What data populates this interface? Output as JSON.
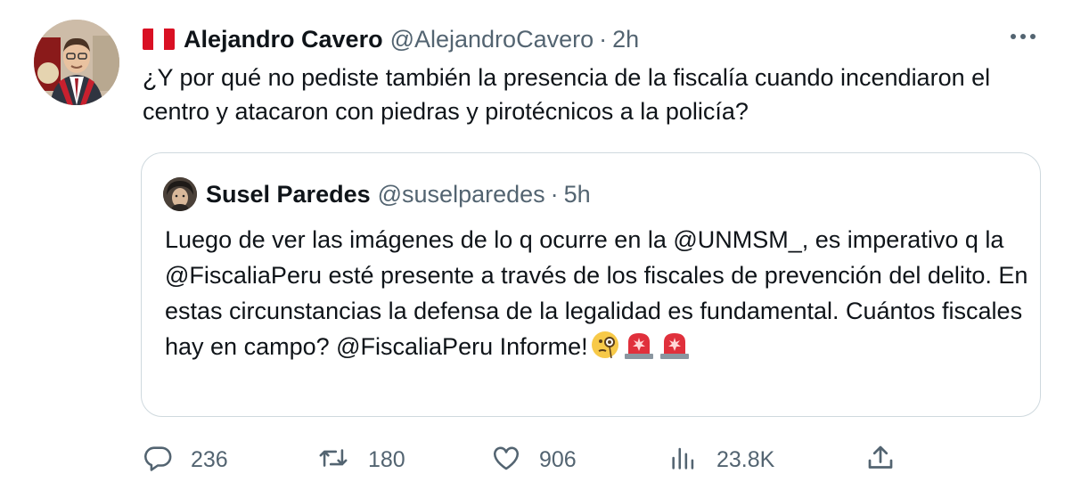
{
  "tweet": {
    "author_name": "Alejandro Cavero",
    "author_handle": "@AlejandroCavero",
    "separator": "·",
    "time": "2h",
    "text": "¿Y por qué no pediste también la presencia de la fiscalía cuando incendiaron el centro y atacaron con piedras y pirotécnicos a la policía?",
    "flag_icon": "peru-flag-icon",
    "colors": {
      "flag_red": "#d91023",
      "text": "#0f1419",
      "secondary": "#536471",
      "border": "#cfd9de"
    }
  },
  "quoted": {
    "author_name": "Susel Paredes",
    "author_handle": "@suselparedes",
    "separator": "·",
    "time": "5h",
    "text": "Luego de ver las imágenes de lo q ocurre en la @UNMSM_, es imperativo q la @FiscaliaPeru esté presente a través de los fiscales de prevención del delito. En estas circunstancias la defensa de la legalidad es fundamental. Cuántos fiscales hay en campo? @FiscaliaPeru Informe!",
    "emojis": [
      "face-with-monocle-emoji",
      "police-light-emoji",
      "police-light-emoji"
    ]
  },
  "actions": {
    "replies": "236",
    "retweets": "180",
    "likes": "906",
    "views": "23.8K",
    "icons": [
      "reply-icon",
      "retweet-icon",
      "like-icon",
      "analytics-icon",
      "share-icon"
    ]
  }
}
